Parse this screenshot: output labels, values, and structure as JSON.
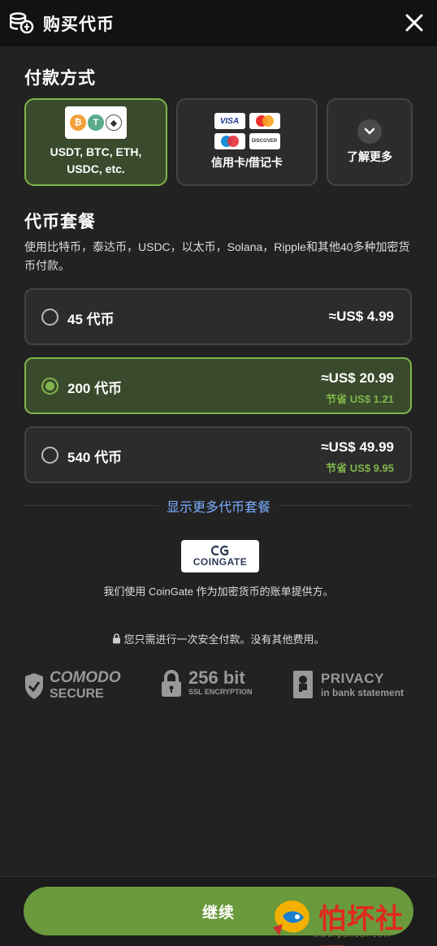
{
  "header": {
    "title": "购买代币"
  },
  "payment": {
    "title": "付款方式",
    "options": [
      {
        "label": "USDT, BTC, ETH, USDC, etc.",
        "selected": true
      },
      {
        "label": "信用卡/借记卡",
        "selected": false
      },
      {
        "label": "了解更多",
        "selected": false
      }
    ],
    "card_brands": [
      "VISA",
      "mastercard",
      "maestro",
      "DISCOVER"
    ]
  },
  "packages": {
    "title": "代币套餐",
    "description": "使用比特币，泰达币，USDC，以太币，Solana，Ripple和其他40多种加密货币付款。",
    "items": [
      {
        "name": "45 代币",
        "price": "≈US$ 4.99",
        "save": "",
        "selected": false
      },
      {
        "name": "200 代币",
        "price": "≈US$ 20.99",
        "save": "节省 US$ 1.21",
        "selected": true
      },
      {
        "name": "540 代币",
        "price": "≈US$ 49.99",
        "save": "节省 US$ 9.95",
        "selected": false
      }
    ],
    "show_more": "显示更多代币套餐"
  },
  "provider": {
    "logo_text": "COINGATE",
    "text": "我们使用 CoinGate 作为加密货币的账单提供方。"
  },
  "security_note": "您只需进行一次安全付款。没有其他费用。",
  "badges": {
    "comodo": {
      "line1": "COMODO",
      "line2": "SECURE"
    },
    "ssl": {
      "line1": "256 bit",
      "line2": "SSL ENCRYPTION"
    },
    "privacy": {
      "line1": "PRIVACY",
      "line2": "in bank statement"
    }
  },
  "cta": {
    "label": "继续"
  },
  "watermark": {
    "text": "怕坏社区",
    "sub": "www.pahuai.com"
  },
  "colors": {
    "accent": "#7fb54a",
    "button": "#6a9a3c",
    "link": "#7aaeff"
  }
}
